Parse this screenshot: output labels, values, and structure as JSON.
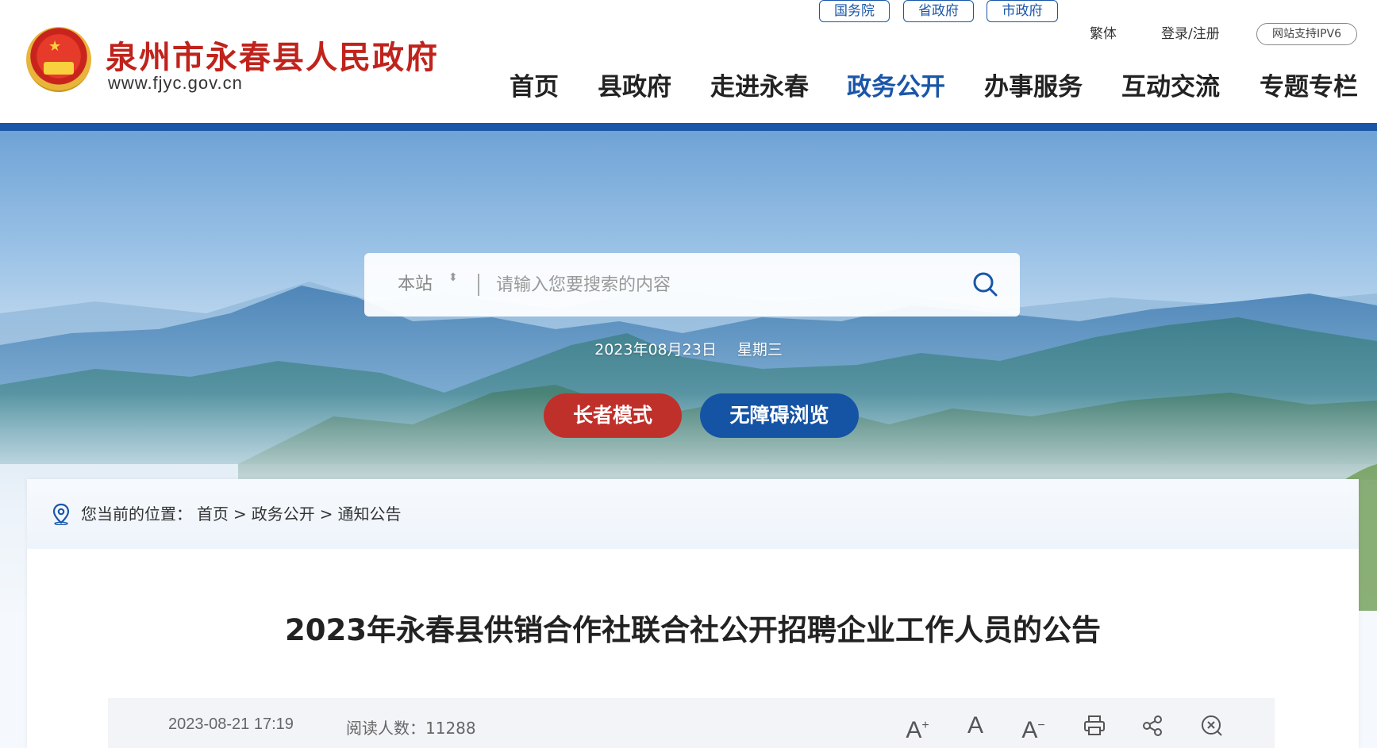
{
  "header": {
    "site_title": "泉州市永春县人民政府",
    "site_url": "www.fjyc.gov.cn",
    "top_links": [
      "国务院",
      "省政府",
      "市政府"
    ],
    "traditional": "繁体",
    "login": "登录/注册",
    "ipv6": "网站支持IPV6",
    "nav": [
      "首页",
      "县政府",
      "走进永春",
      "政务公开",
      "办事服务",
      "互动交流",
      "专题专栏"
    ],
    "active_nav": "政务公开"
  },
  "search": {
    "scope": "本站",
    "placeholder": "请输入您要搜索的内容"
  },
  "date": {
    "date": "2023年08月23日",
    "weekday": "星期三"
  },
  "mode_buttons": {
    "elder": "长者模式",
    "accessible": "无障碍浏览"
  },
  "breadcrumb": {
    "prefix": "您当前的位置：",
    "items": [
      "首页",
      "政务公开",
      "通知公告"
    ],
    "separator": ">"
  },
  "article": {
    "title": "2023年永春县供销合作社联合社公开招聘企业工作人员的公告",
    "publish_time": "2023-08-21 17:19",
    "reads_label": "阅读人数：",
    "reads_count": "11288"
  },
  "tools": {
    "font_increase": "A",
    "font_normal": "A",
    "font_decrease": "A",
    "icons": [
      "font-increase-icon",
      "font-normal-icon",
      "font-decrease-icon",
      "print-icon",
      "share-icon",
      "close-icon"
    ]
  },
  "colors": {
    "brand_red": "#c0231c",
    "brand_blue": "#1a56a8",
    "elder_button": "#c0302b",
    "access_button": "#1553a4"
  }
}
